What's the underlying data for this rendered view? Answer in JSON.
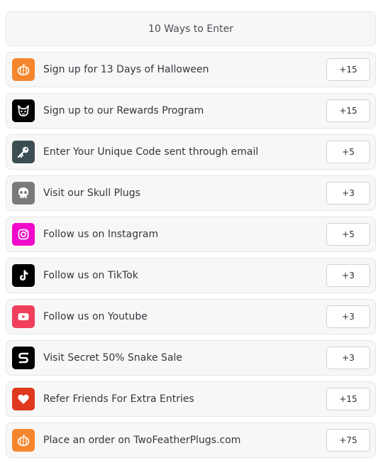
{
  "header": {
    "title": "10 Ways to Enter"
  },
  "entries": [
    {
      "label": "Sign up for 13 Days of Halloween",
      "points": "+15",
      "icon": "pumpkin-icon",
      "color": "#f5862d"
    },
    {
      "label": "Sign up to our Rewards Program",
      "points": "+15",
      "icon": "devil-cat-icon",
      "color": "#000000"
    },
    {
      "label": "Enter Your Unique Code sent through email",
      "points": "+5",
      "icon": "key-icon",
      "color": "#3d4d54"
    },
    {
      "label": "Visit our Skull Plugs",
      "points": "+3",
      "icon": "skull-icon",
      "color": "#7a7a7a"
    },
    {
      "label": "Follow us on Instagram",
      "points": "+5",
      "icon": "instagram-icon",
      "color": "#f20acc"
    },
    {
      "label": "Follow us on TikTok",
      "points": "+3",
      "icon": "tiktok-icon",
      "color": "#000000"
    },
    {
      "label": "Follow us on Youtube",
      "points": "+3",
      "icon": "youtube-icon",
      "color": "#ef3f5c"
    },
    {
      "label": "Visit Secret 50% Snake Sale",
      "points": "+3",
      "icon": "snake-icon",
      "color": "#000000"
    },
    {
      "label": "Refer Friends For Extra Entries",
      "points": "+15",
      "icon": "heart-icon",
      "color": "#e0381f"
    },
    {
      "label": "Place an order on TwoFeatherPlugs.com",
      "points": "+75",
      "icon": "pumpkin-icon",
      "color": "#f5862d"
    }
  ]
}
